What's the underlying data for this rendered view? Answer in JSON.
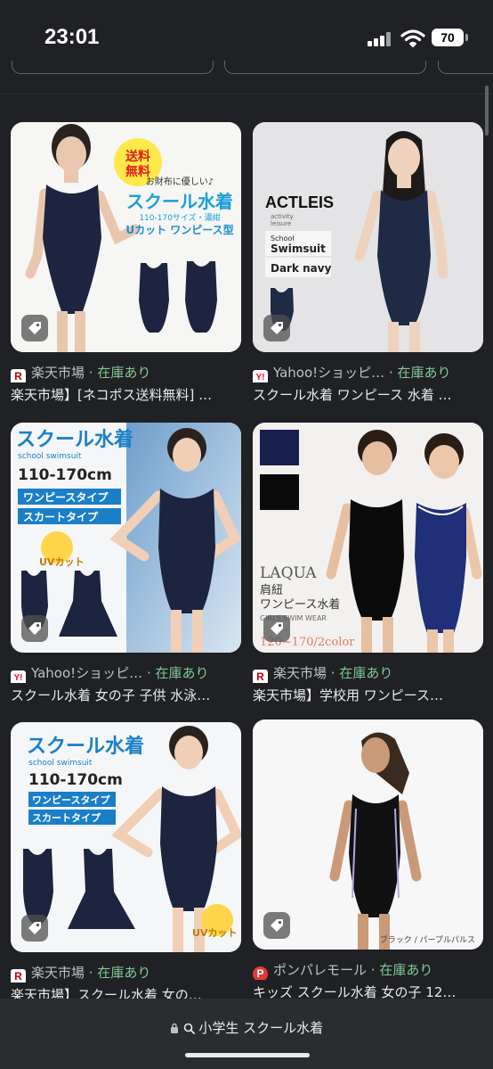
{
  "status_bar": {
    "time": "23:01",
    "battery": "70"
  },
  "results": [
    {
      "source_logo": "R",
      "source": "楽天市場",
      "stock": "在庫あり",
      "title": "楽天市場】[ネコポス送料無料] …",
      "image": {
        "badge_line1": "送料",
        "badge_line2": "無料",
        "tagline": "お財布に優しい♪",
        "heading": "スクール水着",
        "sizes": "110-170サイズ・濃紺",
        "cut": "Uカット ワンピース型"
      }
    },
    {
      "source_logo": "Y!",
      "source": "Yahoo!ショッピ…",
      "stock": "在庫あり",
      "title": "スクール水着 ワンピース 水着 …",
      "image": {
        "brand": "ACTLEIS",
        "brand_sub1": "activity",
        "brand_sub2": "leisure",
        "label1a": "School",
        "label1b": "Swimsuit",
        "label2": "Dark navy"
      }
    },
    {
      "source_logo": "Y!",
      "source": "Yahoo!ショッピ…",
      "stock": "在庫あり",
      "title": "スクール水着 女の子 子供 水泳…",
      "image": {
        "heading": "スクール水着",
        "sub": "school swimsuit",
        "sizes": "110-170cm",
        "type1": "ワンピースタイプ",
        "type2": "スカートタイプ",
        "uv": "UVカット"
      }
    },
    {
      "source_logo": "R",
      "source": "楽天市場",
      "stock": "在庫あり",
      "title": "楽天市場】学校用 ワンピース…",
      "image": {
        "brand": "LAQUA",
        "line1": "肩紐",
        "line2": "ワンピース水着",
        "line3": "GIRLS SWIM WEAR",
        "line4": "120~170/2color"
      }
    },
    {
      "source_logo": "R",
      "source": "楽天市場",
      "stock": "在庫あり",
      "title": "楽天市場】スクール水着 女の…",
      "image": {
        "heading": "スクール水着",
        "sub": "school swimsuit",
        "sizes": "110-170cm",
        "type1": "ワンピースタイプ",
        "type2": "スカートタイプ",
        "uv": "UVカット"
      }
    },
    {
      "source_logo": "P",
      "source": "ポンパレモール",
      "stock": "在庫あり",
      "title": "キッズ スクール水着 女の子 12…",
      "image": {
        "caption": "ブラック / パープルパルス"
      }
    }
  ],
  "separator": " · ",
  "url_bar": {
    "query": "小学生 スクール水着"
  },
  "colors": {
    "background": "#202124",
    "stock_green": "#81c995",
    "rakuten_red": "#bf0000",
    "yahoo_red": "#ff0033",
    "navy": "#1d2440"
  }
}
